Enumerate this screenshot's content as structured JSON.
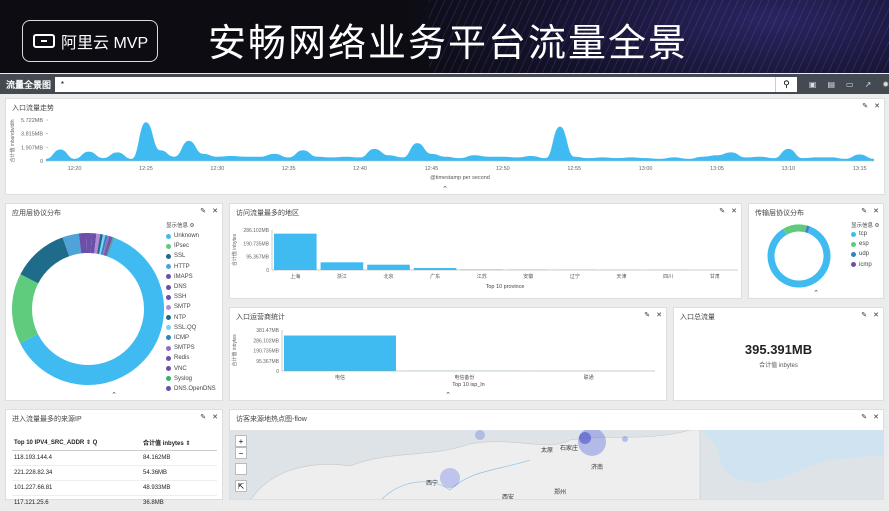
{
  "banner": {
    "logo_text": "阿里云 MVP",
    "title": "安畅网络业务平台流量全景"
  },
  "toolbar": {
    "name": "流量全景图",
    "query_value": "*",
    "search_icon": "search-icon",
    "icons": [
      "new-icon",
      "save-icon",
      "open-icon",
      "share-icon",
      "gear-icon"
    ]
  },
  "panels": {
    "trend": {
      "title": "入口流量走势"
    },
    "app_protocol": {
      "title": "应用层协议分布",
      "legend_title": "显示信息 ⚙"
    },
    "region": {
      "title": "访问流量最多的地区"
    },
    "transport": {
      "title": "传输层协议分布",
      "legend_title": "显示信息 ⚙"
    },
    "isp": {
      "title": "入口运营商统计"
    },
    "total": {
      "title": "入口总流量",
      "value": "395.391MB",
      "label": "合计值 inbytes"
    },
    "sources": {
      "title": "进入流量最多的来源IP",
      "columns": [
        "Top 10 IPV4_SRC_ADDR ⇕ Q",
        "合计值 inbytes ⇕"
      ],
      "rows": [
        [
          "118.193.144.4",
          "84.162MB"
        ],
        [
          "221.228.82.34",
          "54.36MB"
        ],
        [
          "101.227.66.81",
          "48.933MB"
        ],
        [
          "117.121.25.6",
          "36.8MB"
        ]
      ]
    },
    "map": {
      "title": "访客来源地热点图-flow",
      "controls": [
        "+",
        "−",
        "",
        "⇱"
      ],
      "cities": [
        "太原",
        "石家庄",
        "济南",
        "西宁",
        "郑州",
        "西安"
      ]
    }
  },
  "chart_data": [
    {
      "type": "area",
      "ylabel": "合计值 inbandwidth",
      "xlabel": "@timestamp per second",
      "yticks": [
        "5.722MB",
        "3.815MB",
        "1.907MB",
        "0"
      ],
      "xticks": [
        "12:20",
        "12:25",
        "12:30",
        "12:35",
        "12:40",
        "12:45",
        "12:50",
        "12:55",
        "13:00",
        "13:05",
        "13:10",
        "13:15"
      ],
      "x": [
        "12:18",
        "12:19",
        "12:20",
        "12:21",
        "12:22",
        "12:23",
        "12:24",
        "12:25",
        "12:26",
        "12:27",
        "12:28",
        "12:29",
        "12:30",
        "12:31",
        "12:32",
        "12:33",
        "12:34",
        "12:35",
        "12:36",
        "12:37",
        "12:38",
        "12:39",
        "12:40",
        "12:41",
        "12:42",
        "12:43",
        "12:44",
        "12:45",
        "12:46",
        "12:47",
        "12:48",
        "12:49",
        "12:50",
        "12:51",
        "12:52",
        "12:53",
        "12:54",
        "12:55",
        "12:56",
        "12:57",
        "12:58",
        "12:59",
        "13:00",
        "13:01",
        "13:02",
        "13:03",
        "13:04",
        "13:05",
        "13:06",
        "13:07",
        "13:08",
        "13:09",
        "13:10",
        "13:11",
        "13:12",
        "13:13",
        "13:14",
        "13:15",
        "13:16"
      ],
      "values": [
        0.3,
        1.6,
        0.3,
        1.3,
        0.4,
        1.2,
        0.3,
        5.4,
        1.5,
        0.6,
        2.8,
        1.0,
        0.6,
        0.7,
        0.6,
        0.6,
        1.0,
        0.5,
        1.5,
        0.6,
        0.5,
        0.6,
        0.5,
        1.7,
        0.8,
        0.5,
        2.5,
        1.0,
        0.6,
        0.4,
        0.8,
        0.6,
        0.6,
        0.5,
        0.7,
        0.4,
        4.8,
        0.6,
        0.4,
        0.5,
        0.4,
        0.5,
        0.4,
        0.3,
        0.5,
        0.3,
        0.6,
        0.8,
        1.2,
        0.5,
        0.6,
        0.4,
        1.7,
        0.4,
        0.5,
        0.5,
        0.3,
        0.9,
        0.3
      ],
      "ylim": [
        0,
        5.722
      ]
    },
    {
      "type": "pie",
      "title": "应用层协议分布",
      "categories": [
        "Unknown",
        "IPsec",
        "SSL",
        "HTTP",
        "IMAPS",
        "DNS",
        "SSH",
        "SMTP",
        "NTP",
        "SSL.QQ",
        "ICMP",
        "SMTPS",
        "Redis",
        "VNC",
        "Syslog",
        "DNS.OpenDNS"
      ],
      "values": [
        62.0,
        15.0,
        12.0,
        3.5,
        1.5,
        1.2,
        1.0,
        0.8,
        0.6,
        0.5,
        0.5,
        0.4,
        0.4,
        0.3,
        0.2,
        0.1
      ],
      "colors": [
        "#3fbbf2",
        "#5ecb7d",
        "#1f6b8a",
        "#4ea3d9",
        "#6b4fa8",
        "#6b4fa8",
        "#6b4fa8",
        "#b18ad8",
        "#1f6b8a",
        "#7ecef5",
        "#2e86c1",
        "#8e6fc7",
        "#6b4fa8",
        "#6b4fa8",
        "#3bb06e",
        "#6b4fa8"
      ]
    },
    {
      "type": "bar",
      "xlabel": "Top 10 province",
      "ylabel": "合计值 inbytes",
      "yticks": [
        "286.102MB",
        "190.735MB",
        "95.367MB",
        "0"
      ],
      "categories": [
        "上海",
        "浙江",
        "北京",
        "广东",
        "江苏",
        "安徽",
        "辽宁",
        "天津",
        "四川",
        "甘肃"
      ],
      "values": [
        260,
        55,
        38,
        14,
        3,
        1.5,
        1,
        0.5,
        0.5,
        0.3
      ],
      "ylim": [
        0,
        286.102
      ],
      "color": "#3fbbf2"
    },
    {
      "type": "pie",
      "title": "传输层协议分布",
      "categories": [
        "tcp",
        "esp",
        "udp",
        "icmp"
      ],
      "values": [
        86.0,
        12.5,
        1.2,
        0.3
      ],
      "colors": [
        "#3fbbf2",
        "#5ecb7d",
        "#2e86c1",
        "#6b4fa8"
      ]
    },
    {
      "type": "bar",
      "xlabel": "Top 10 isp_ln",
      "ylabel": "合计值 inbytes",
      "yticks": [
        "381.47MB",
        "286.102MB",
        "190.735MB",
        "95.367MB",
        "0"
      ],
      "categories": [
        "电信",
        "电信备份",
        "联通"
      ],
      "values": [
        330,
        1,
        0.5
      ],
      "ylim": [
        0,
        381.47
      ],
      "color": "#3fbbf2"
    }
  ]
}
